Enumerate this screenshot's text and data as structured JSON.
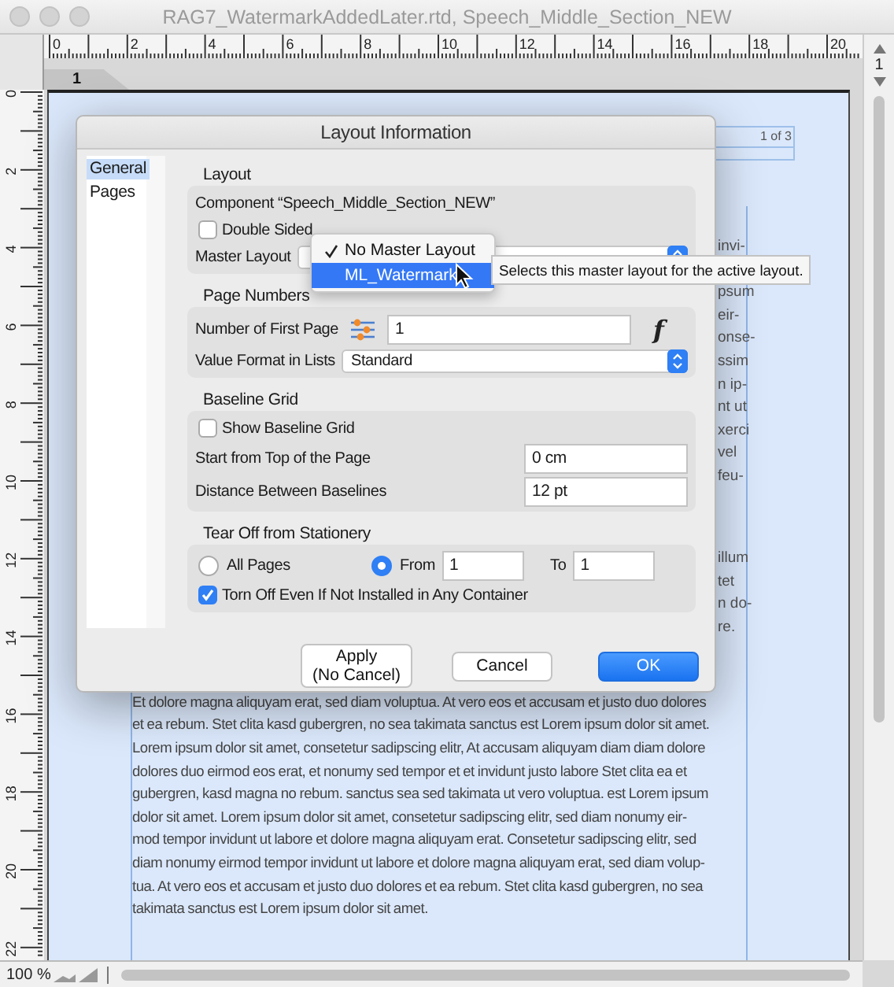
{
  "window": {
    "title": "RAG7_WatermarkAddedLater.rtd, Speech_Middle_Section_NEW"
  },
  "horizontal_ruler": {
    "labels": [
      "0",
      "2",
      "4",
      "6",
      "8",
      "10",
      "12",
      "14",
      "16",
      "18",
      "20"
    ]
  },
  "vertical_ruler": {
    "labels": [
      "0",
      "2",
      "4",
      "6",
      "8",
      "10",
      "12",
      "14",
      "16",
      "18",
      "20",
      "22"
    ]
  },
  "page_tabs": [
    {
      "label": "1",
      "selected": true
    }
  ],
  "page_indicator": "1",
  "document": {
    "header_text": "1 of 3",
    "fragment_blocks": [
      [
        "invi-"
      ],
      [
        "psum",
        "eir-",
        "onse-",
        "ssim",
        "n ip-",
        "nt ut",
        "xerci",
        "vel",
        "feu-"
      ],
      [
        "illum",
        "tet",
        "n do-",
        "re."
      ]
    ],
    "paragraph_lines": [
      "Et dolore magna aliquyam erat, sed diam voluptua. At vero eos et accusam et justo duo dolores",
      "et ea rebum. Stet clita kasd gubergren, no sea takimata sanctus est Lorem ipsum dolor sit amet.",
      "Lorem ipsum dolor sit amet, consetetur sadipscing elitr, At accusam aliquyam diam diam dolore",
      "dolores duo eirmod eos erat, et nonumy sed tempor et et invidunt justo labore Stet clita ea et",
      "gubergren, kasd magna no rebum. sanctus sea sed takimata ut vero voluptua. est Lorem ipsum",
      "dolor sit amet. Lorem ipsum dolor sit amet, consetetur sadipscing elitr, sed diam nonumy eir-",
      "mod tempor invidunt ut labore et dolore magna aliquyam erat. Consetetur sadipscing elitr, sed",
      "diam nonumy eirmod tempor invidunt ut labore et dolore magna aliquyam erat, sed diam volup-",
      "tua. At vero eos et accusam et justo duo dolores et ea rebum. Stet clita kasd gubergren, no sea",
      "takimata sanctus est Lorem ipsum dolor sit amet."
    ]
  },
  "dialog": {
    "title": "Layout Information",
    "sidebar": [
      {
        "label": "General",
        "selected": true
      },
      {
        "label": "Pages",
        "selected": false
      }
    ],
    "sections": [
      {
        "title": "Layout",
        "rows": [
          {
            "kind": "text",
            "text": "Component “Speech_Middle_Section_NEW”"
          },
          {
            "kind": "checkbox",
            "label": "Double Sided",
            "checked": false
          },
          {
            "kind": "popup",
            "label": "Master Layout"
          }
        ]
      },
      {
        "title": "Page Numbers",
        "rows": [
          {
            "kind": "number",
            "label": "Number of First Page",
            "value": "1",
            "function_label": "f"
          },
          {
            "kind": "popup",
            "label": "Value Format in Lists",
            "value": "Standard"
          }
        ]
      },
      {
        "title": "Baseline Grid",
        "rows": [
          {
            "kind": "checkbox",
            "label": "Show Baseline Grid",
            "checked": false
          },
          {
            "kind": "field",
            "label": "Start from Top of the Page",
            "value": "0 cm"
          },
          {
            "kind": "field",
            "label": "Distance Between Baselines",
            "value": "12 pt"
          }
        ]
      },
      {
        "title": "Tear Off from Stationery",
        "rows": [
          {
            "kind": "range",
            "options": [
              {
                "label": "All Pages",
                "selected": false
              },
              {
                "label": "From",
                "selected": true
              }
            ],
            "from": "1",
            "to_label": "To",
            "to": "1"
          },
          {
            "kind": "checkbox",
            "label": "Torn Off Even If Not Installed in Any Container",
            "checked": true
          }
        ]
      }
    ],
    "buttons": [
      {
        "label": "Apply\n(No Cancel)",
        "default": false
      },
      {
        "label": "Cancel",
        "default": false
      },
      {
        "label": "OK",
        "default": true
      }
    ]
  },
  "master_layout_menu": {
    "items": [
      {
        "label": "No Master Layout",
        "checked": true,
        "selected": false
      },
      {
        "label": "ML_Watermark",
        "checked": false,
        "selected": true
      }
    ]
  },
  "tooltip": "Selects this master layout for the active layout.",
  "status_bar": {
    "zoom": "100 %"
  }
}
